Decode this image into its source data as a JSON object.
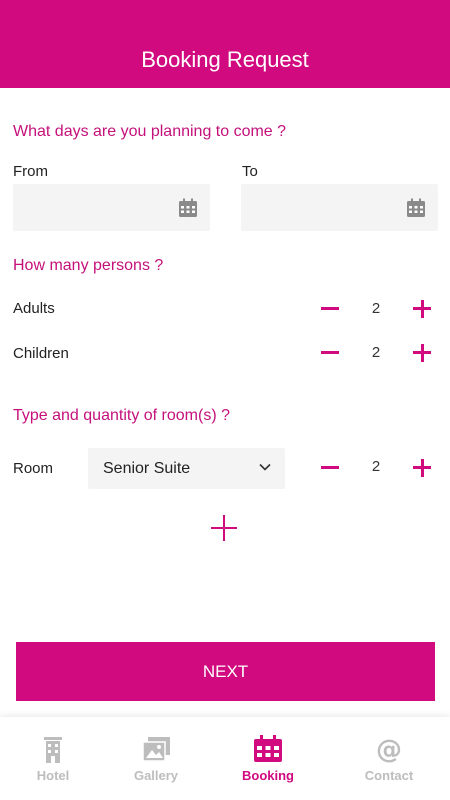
{
  "header": {
    "title": "Booking Request"
  },
  "dates": {
    "heading": "What days are you planning to come ?",
    "from_label": "From",
    "to_label": "To",
    "from_value": "",
    "to_value": ""
  },
  "persons": {
    "heading": "How many persons ?",
    "adults_label": "Adults",
    "adults_value": "2",
    "children_label": "Children",
    "children_value": "2"
  },
  "rooms": {
    "heading": "Type and quantity of room(s) ?",
    "room_label": "Room",
    "room_type": "Senior Suite",
    "room_quantity": "2"
  },
  "actions": {
    "next_label": "NEXT"
  },
  "tabbar": {
    "tabs": [
      {
        "label": "Hotel",
        "icon": "hotel-icon"
      },
      {
        "label": "Gallery",
        "icon": "gallery-icon"
      },
      {
        "label": "Booking",
        "icon": "calendar-icon"
      },
      {
        "label": "Contact",
        "icon": "at-icon"
      }
    ],
    "active": "Booking"
  },
  "colors": {
    "accent": "#d10a7f",
    "inactive": "#bdbdbd",
    "field_bg": "#f4f4f4"
  }
}
